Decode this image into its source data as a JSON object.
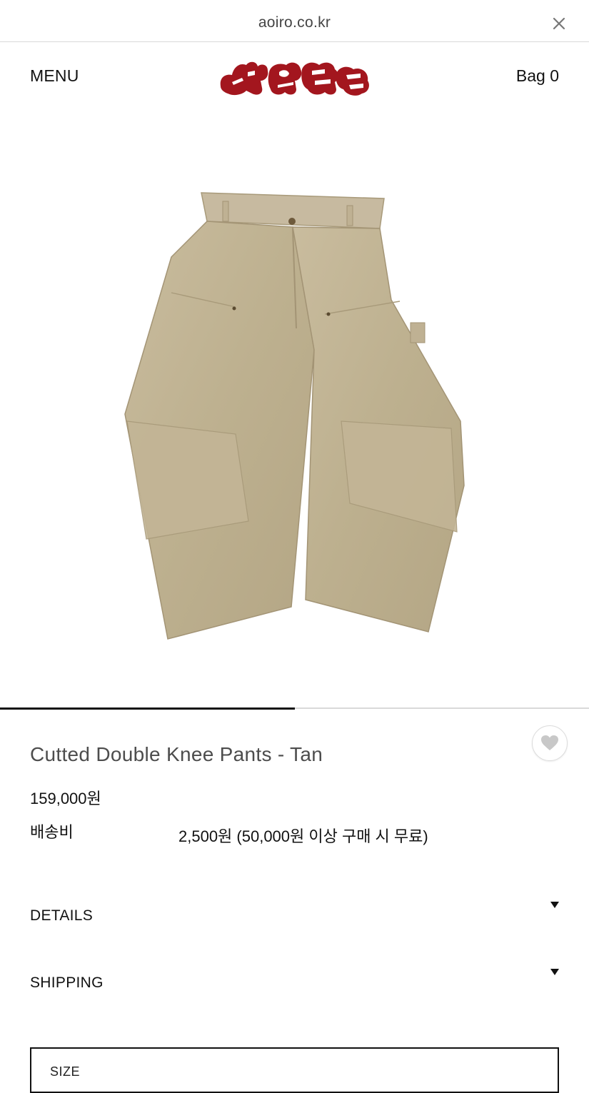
{
  "browser": {
    "url": "aoiro.co.kr",
    "close_icon": "close-icon"
  },
  "header": {
    "menu_label": "MENU",
    "bag_label": "Bag 0",
    "logo_text": "아오이로",
    "logo_color": "#a3161e"
  },
  "gallery": {
    "image": "product-image-tan-double-knee-pants",
    "progress": 0.5,
    "progress_color": "#111111",
    "track_color": "#d9d9d9"
  },
  "product": {
    "title": "Cutted Double Knee Pants - Tan",
    "price": "159,000원",
    "shipping_label": "배송비",
    "shipping_value": "2,500원 (50,000원 이상 구매 시 무료)",
    "wishlist_icon": "heart-icon",
    "wishlist_color": "#c8c8c8"
  },
  "accordions": [
    {
      "label": "DETAILS",
      "icon": "caret-down-icon"
    },
    {
      "label": "SHIPPING",
      "icon": "caret-down-icon"
    }
  ],
  "size_select": {
    "label": "SIZE"
  }
}
